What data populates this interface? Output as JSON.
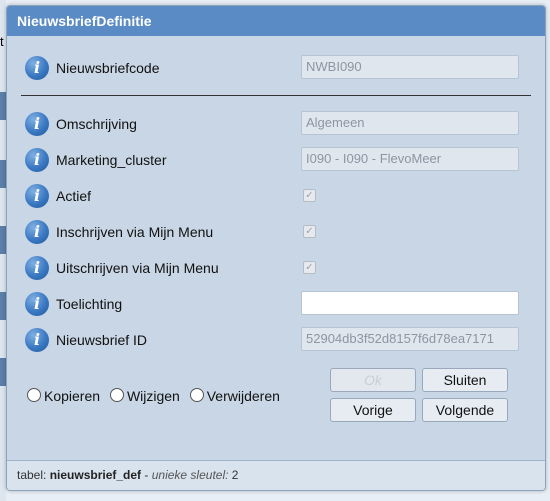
{
  "background": {
    "fragment_text": "t"
  },
  "dialog": {
    "title": "NieuwsbriefDefinitie",
    "fields": [
      {
        "label": "Nieuwsbriefcode",
        "value": "NWBI090",
        "type": "text"
      },
      {
        "label": "Omschrijving",
        "value": "Algemeen",
        "type": "text"
      },
      {
        "label": "Marketing_cluster",
        "value": "I090 - I090 - FlevoMeer",
        "type": "text"
      },
      {
        "label": "Actief",
        "checked": true,
        "type": "checkbox"
      },
      {
        "label": "Inschrijven via Mijn Menu",
        "checked": true,
        "type": "checkbox"
      },
      {
        "label": "Uitschrijven via Mijn Menu",
        "checked": true,
        "type": "checkbox"
      },
      {
        "label": "Toelichting",
        "value": "",
        "type": "text"
      },
      {
        "label": "Nieuwsbrief ID",
        "value": "52904db3f52d8157f6d78ea7171",
        "type": "text"
      }
    ],
    "radios": [
      "Kopieren",
      "Wijzigen",
      "Verwijderen"
    ],
    "buttons": {
      "ok": "Ok",
      "sluiten": "Sluiten",
      "vorige": "Vorige",
      "volgende": "Volgende"
    },
    "footer": {
      "prefix": "tabel:",
      "table": "nieuwsbrief_def",
      "separator": " - ",
      "key_label": "unieke sleutel:",
      "key_value": "2"
    }
  },
  "icons": {
    "info": "info-icon",
    "checkmark": "✓"
  }
}
